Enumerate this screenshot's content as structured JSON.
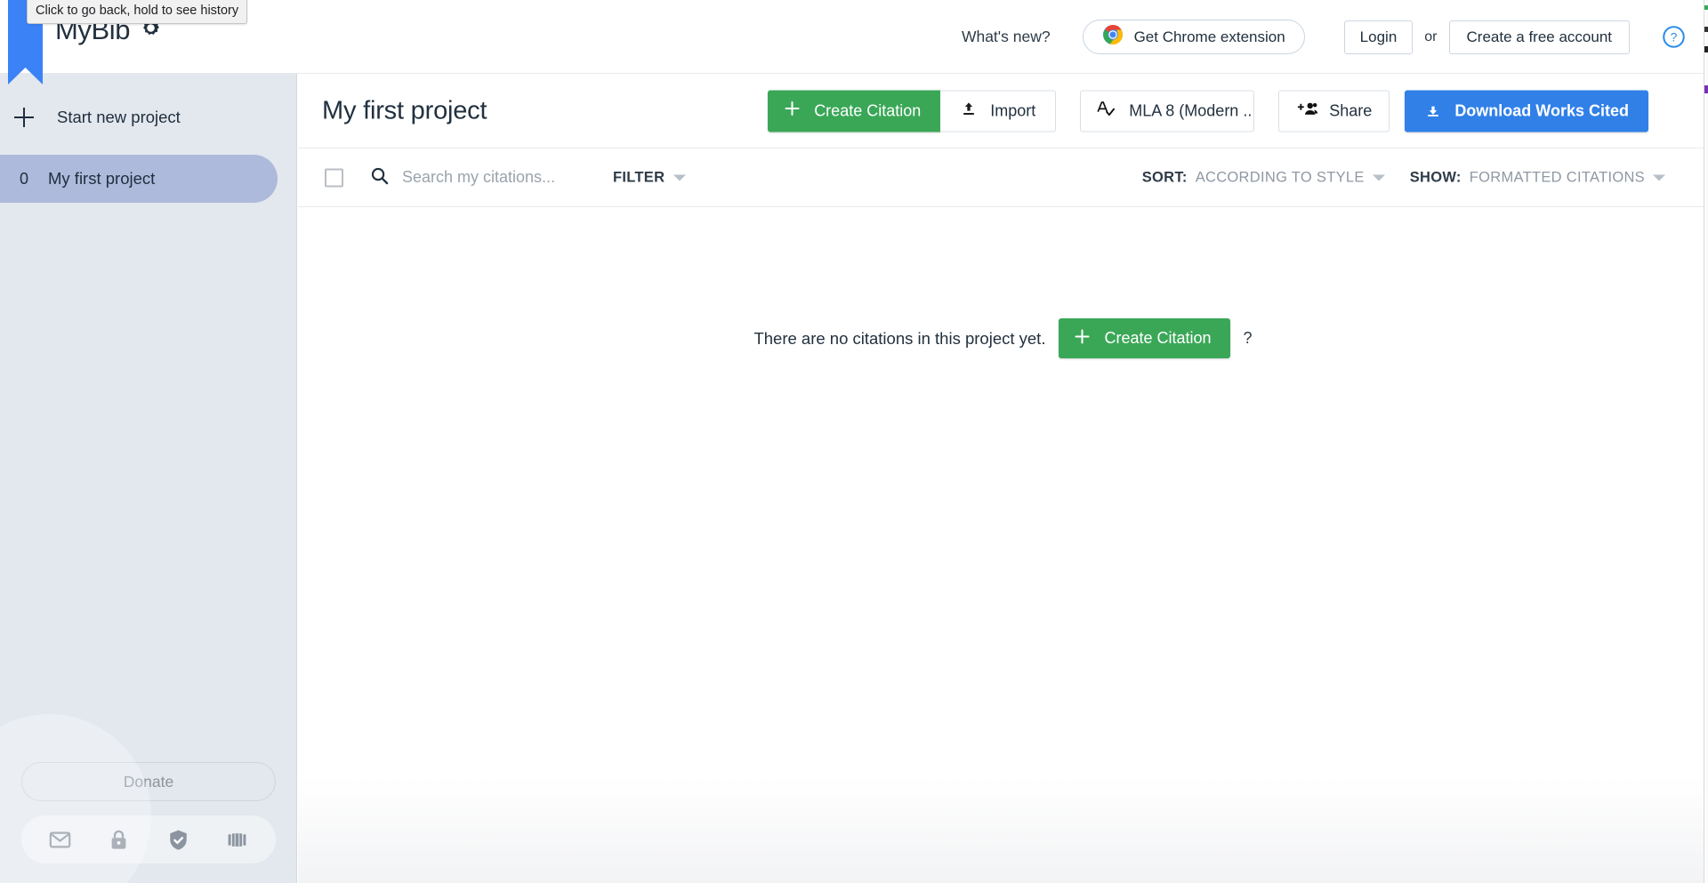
{
  "browser": {
    "back_tooltip": "Click to go back, hold to see history",
    "bookmark_color": "#3b82f6"
  },
  "header": {
    "logo_text": "MyBib",
    "logo_icon": "gear-star-icon",
    "whats_new": "What's new?",
    "chrome_extension": "Get Chrome extension",
    "chrome_icon": "chrome-icon",
    "login": "Login",
    "or": "or",
    "create_account": "Create a free account",
    "help_icon": "help-circle-icon",
    "help_color": "#2a8ce8"
  },
  "sidebar": {
    "start_new_project": "Start new project",
    "start_new_icon": "plus-icon",
    "projects": [
      {
        "count": "0",
        "name": "My first project",
        "active": true
      }
    ],
    "donate": "Donate",
    "active_color": "#aebadb",
    "background_color": "#e3e8ee",
    "footer_icons": [
      "envelope-icon",
      "lock-icon",
      "shield-check-icon",
      "book-icon"
    ]
  },
  "main": {
    "project_title": "My first project",
    "toolbar": {
      "create_citation": "Create Citation",
      "create_citation_icon": "plus-icon",
      "create_citation_color": "#3aa757",
      "import": "Import",
      "import_icon": "upload-icon",
      "style": "MLA 8 (Modern ...",
      "style_icon": "spellcheck-a-icon",
      "share": "Share",
      "share_icon": "person-add-icon",
      "download": "Download Works Cited",
      "download_icon": "download-icon",
      "download_color": "#3080e8"
    },
    "filterbar": {
      "select_all_icon": "checkbox-unchecked-icon",
      "search_placeholder": "Search my citations...",
      "search_value": "",
      "search_icon": "search-icon",
      "filter_label": "FILTER",
      "filter_caret_icon": "chevron-down-icon",
      "sort_key": "SORT:",
      "sort_value": "ACCORDING TO STYLE",
      "sort_caret_icon": "chevron-down-icon",
      "show_key": "SHOW:",
      "show_value": "FORMATTED CITATIONS",
      "show_caret_icon": "chevron-down-icon"
    },
    "empty_state": {
      "message": "There are no citations in this project yet.",
      "button_label": "Create Citation",
      "button_icon": "plus-icon",
      "help_label": "?"
    }
  }
}
